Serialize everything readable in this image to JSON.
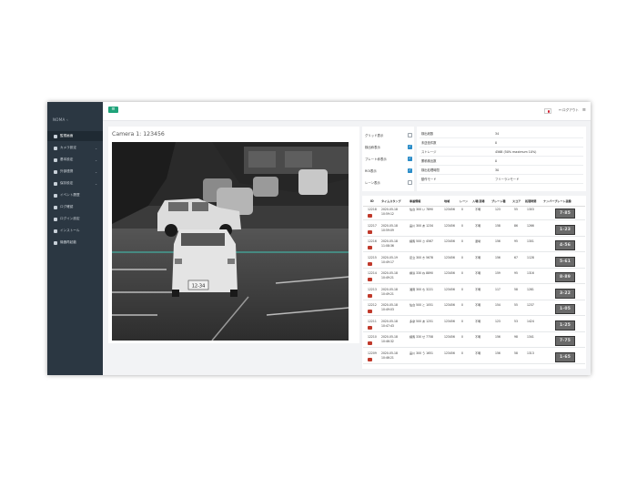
{
  "sidebar": {
    "brand": "NOMA",
    "items": [
      {
        "label": "監視画面",
        "icon": "monitor-icon",
        "has_caret": false
      },
      {
        "label": "カメラ設定",
        "icon": "camera-icon",
        "has_caret": true
      },
      {
        "label": "基本設定",
        "icon": "settings-icon",
        "has_caret": true
      },
      {
        "label": "外部連携",
        "icon": "link-icon",
        "has_caret": true
      },
      {
        "label": "保存設定",
        "icon": "save-icon",
        "has_caret": true
      },
      {
        "label": "イベント履歴",
        "icon": "history-icon",
        "has_caret": false
      },
      {
        "label": "ログ確認",
        "icon": "log-icon",
        "has_caret": false
      },
      {
        "label": "ログイン設定",
        "icon": "user-icon",
        "has_caret": false
      },
      {
        "label": "インストール",
        "icon": "install-icon",
        "has_caret": false
      },
      {
        "label": "機器再起動",
        "icon": "power-icon",
        "has_caret": false
      }
    ]
  },
  "topbar": {
    "menu_icon": "menu-icon",
    "logout_label": "ログアウト",
    "flag_icon": "japan-flag-icon",
    "menu_right_icon": "hamburger-icon"
  },
  "camera": {
    "title": "Camera 1: 123456",
    "plate_text": "12-34"
  },
  "options": [
    {
      "label": "グリッド表示",
      "checked": false
    },
    {
      "label": "検出枠表示",
      "checked": true
    },
    {
      "label": "プレート枠表示",
      "checked": true
    },
    {
      "label": "ROI表示",
      "checked": true
    },
    {
      "label": "レーン表示",
      "checked": false
    }
  ],
  "info": [
    {
      "key": "検出総数",
      "value": "34"
    },
    {
      "key": "未送信件数",
      "value": "0"
    },
    {
      "key": "ストレージ",
      "value": "4568 (50% maximum 10%)"
    },
    {
      "key": "累積検出数",
      "value": "0"
    },
    {
      "key": "検出処理時間",
      "value": "30"
    },
    {
      "key": "動作モード",
      "value": "フリーランモード"
    }
  ],
  "table": {
    "headers": [
      "ID",
      "タイムスタンプ",
      "車番情報",
      "地域",
      "レーン",
      "入場/退場",
      "プレート種",
      "スコア",
      "処理時間",
      "ナンバープレート画像"
    ],
    "rows": [
      {
        "id": "12218",
        "date": "2020-05-18",
        "time": "10:59:12",
        "plate": "仙台 300 い 7890",
        "code": "123456",
        "lane": "0",
        "dir": "不明",
        "type": "123",
        "score": "55",
        "ms": "1303",
        "thumb": "7-85"
      },
      {
        "id": "12217",
        "date": "2020-05-18",
        "time": "10:59:09",
        "plate": "品川 300 あ 1234",
        "code": "123456",
        "lane": "0",
        "dir": "不明",
        "type": "158",
        "score": "86",
        "ms": "1266",
        "thumb": "1-23"
      },
      {
        "id": "12216",
        "date": "2020-05-18",
        "time": "11:08:36",
        "plate": "練馬 500 さ 4567",
        "code": "123456",
        "lane": "0",
        "dir": "退場",
        "type": "156",
        "score": "95",
        "ms": "1301",
        "thumb": "4-56"
      },
      {
        "id": "12215",
        "date": "2020-05-19",
        "time": "10:49:17",
        "plate": "足立 300 き 5678",
        "code": "123456",
        "lane": "0",
        "dir": "不明",
        "type": "156",
        "score": "67",
        "ms": "1128",
        "thumb": "5-61"
      },
      {
        "id": "12214",
        "date": "2020-05-18",
        "time": "10:49:21",
        "plate": "横浜 330 ね 8890",
        "code": "123456",
        "lane": "0",
        "dir": "不明",
        "type": "159",
        "score": "95",
        "ms": "1316",
        "thumb": "8-89"
      },
      {
        "id": "12213",
        "date": "2020-05-18",
        "time": "10:49:21",
        "plate": "湘南 300 ち 3221",
        "code": "123456",
        "lane": "0",
        "dir": "不明",
        "type": "117",
        "score": "58",
        "ms": "1281",
        "thumb": "3-22"
      },
      {
        "id": "12212",
        "date": "2020-05-18",
        "time": "10:49:03",
        "plate": "仙台 500 と 1051",
        "code": "123456",
        "lane": "0",
        "dir": "不明",
        "type": "154",
        "score": "55",
        "ms": "1237",
        "thumb": "1-05"
      },
      {
        "id": "12211",
        "date": "2020-05-18",
        "time": "10:47:43",
        "plate": "多摩 500 あ 1251",
        "code": "123456",
        "lane": "0",
        "dir": "不明",
        "type": "123",
        "score": "53",
        "ms": "1424",
        "thumb": "1-25"
      },
      {
        "id": "12210",
        "date": "2020-05-18",
        "time": "10:46:32",
        "plate": "練馬 330 せ 7758",
        "code": "123456",
        "lane": "0",
        "dir": "不明",
        "type": "156",
        "score": "98",
        "ms": "1341",
        "thumb": "7-75"
      },
      {
        "id": "12209",
        "date": "2020-05-18",
        "time": "10:46:21",
        "plate": "品川 300 う 1651",
        "code": "123456",
        "lane": "0",
        "dir": "不明",
        "type": "156",
        "score": "58",
        "ms": "1313",
        "thumb": "1-65"
      }
    ]
  },
  "colors": {
    "sidebar_bg": "#2b3742",
    "accent_green": "#1fa37a",
    "checkbox_blue": "#2a8cc8",
    "record_red": "#c0392b",
    "lane_line": "#3fc6b6"
  }
}
